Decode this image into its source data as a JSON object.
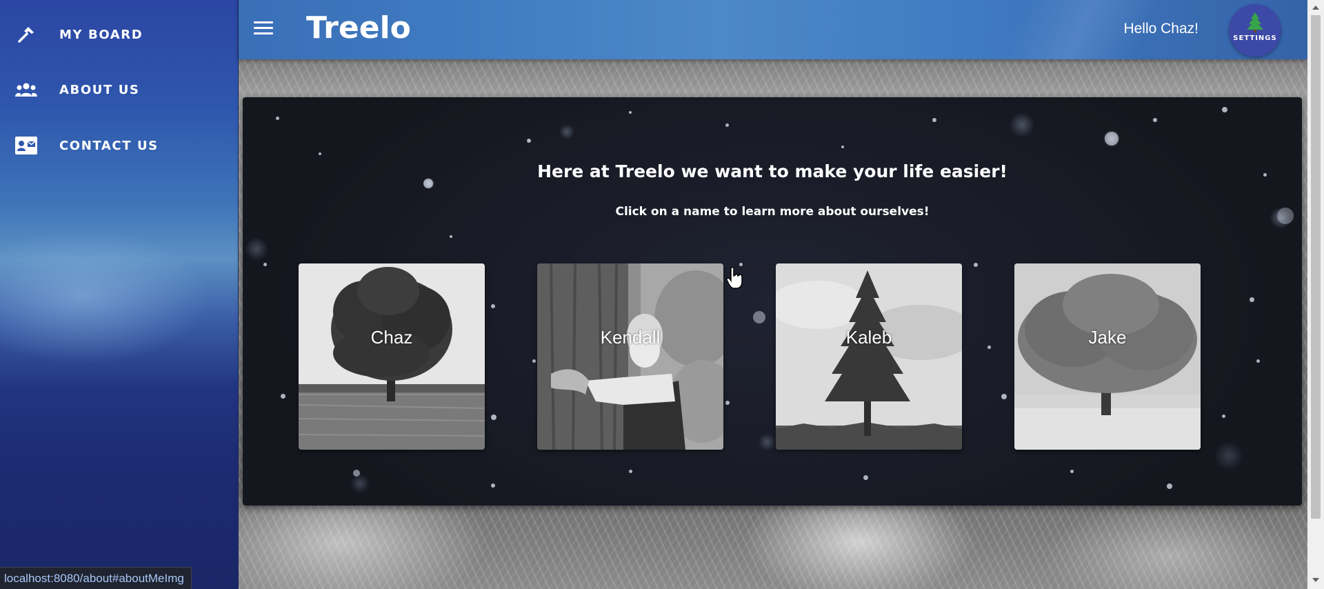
{
  "sidebar": {
    "items": [
      {
        "label": "MY BOARD",
        "icon": "hammer-icon"
      },
      {
        "label": "ABOUT US",
        "icon": "people-icon"
      },
      {
        "label": "CONTACT US",
        "icon": "contact-card-icon"
      }
    ]
  },
  "header": {
    "title": "Treelo",
    "greeting": "Hello Chaz!",
    "settings_label": "SETTINGS",
    "menu_icon": "hamburger-menu-icon"
  },
  "about": {
    "heading": "Here at Treelo we want to make your life easier!",
    "subheading": "Click on a name to learn more about ourselves!",
    "members": [
      {
        "name": "Chaz",
        "image": "oak-tree-in-field"
      },
      {
        "name": "Kendall",
        "image": "man-hugging-tree"
      },
      {
        "name": "Kaleb",
        "image": "pine-tree"
      },
      {
        "name": "Jake",
        "image": "round-tree-in-meadow"
      }
    ]
  },
  "status_bar": {
    "url": "localhost:8080/about#aboutMeImg"
  },
  "colors": {
    "sidebar": "#2b46a4",
    "header": "#3f7ac0",
    "settings_button": "#3d49a6",
    "panel": "#1b1e2b"
  }
}
